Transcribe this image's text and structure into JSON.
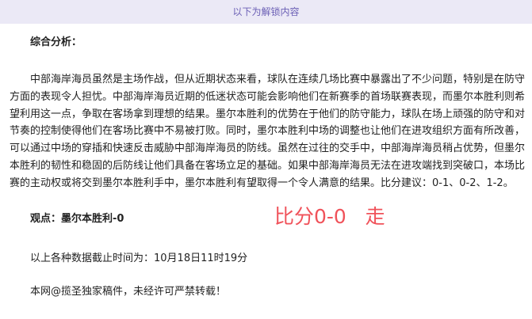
{
  "banner": {
    "text": "以下为解锁内容"
  },
  "article": {
    "heading": "综合分析：",
    "analysis": "中部海岸海员虽然是主场作战，但从近期状态来看，球队在连续几场比赛中暴露出了不少问题，特别是在防守方面的表现令人担忧。中部海岸海员近期的低迷状态可能会影响他们在新赛季的首场联赛表现，而墨尔本胜利则希望利用这一点，争取在客场拿到理想的结果。墨尔本胜利的优势在于他们的防守能力，球队在场上顽强的防守和对节奏的控制使得他们在客场比赛中不易被打败。同时，墨尔本胜利中场的调整也让他们在进攻组织方面有所改善，可以通过中场的穿插和快速反击威胁中部海岸海员的防线。虽然在过往的交手中，中部海岸海员稍占优势，但墨尔本胜利的韧性和稳固的后防线让他们具备在客场立足的基础。如果中部海岸海员无法在进攻端找到突破口，本场比赛的主动权或将交到墨尔本胜利手中，墨尔本胜利有望取得一个令人满意的结果。比分建议：0-1、0-2、1-2。",
    "viewpoint": "观点：墨尔本胜利-0",
    "stamp": "比分0-0   走",
    "cutoff": "以上各种数据截止时间为：10月18日11时19分",
    "copyright": "本网@揽圣独家稿件，未经许可严禁转载！"
  },
  "colors": {
    "banner_bg": "#ebe9f6",
    "banner_text": "#6b5fb5",
    "stamp": "#f0525a"
  }
}
